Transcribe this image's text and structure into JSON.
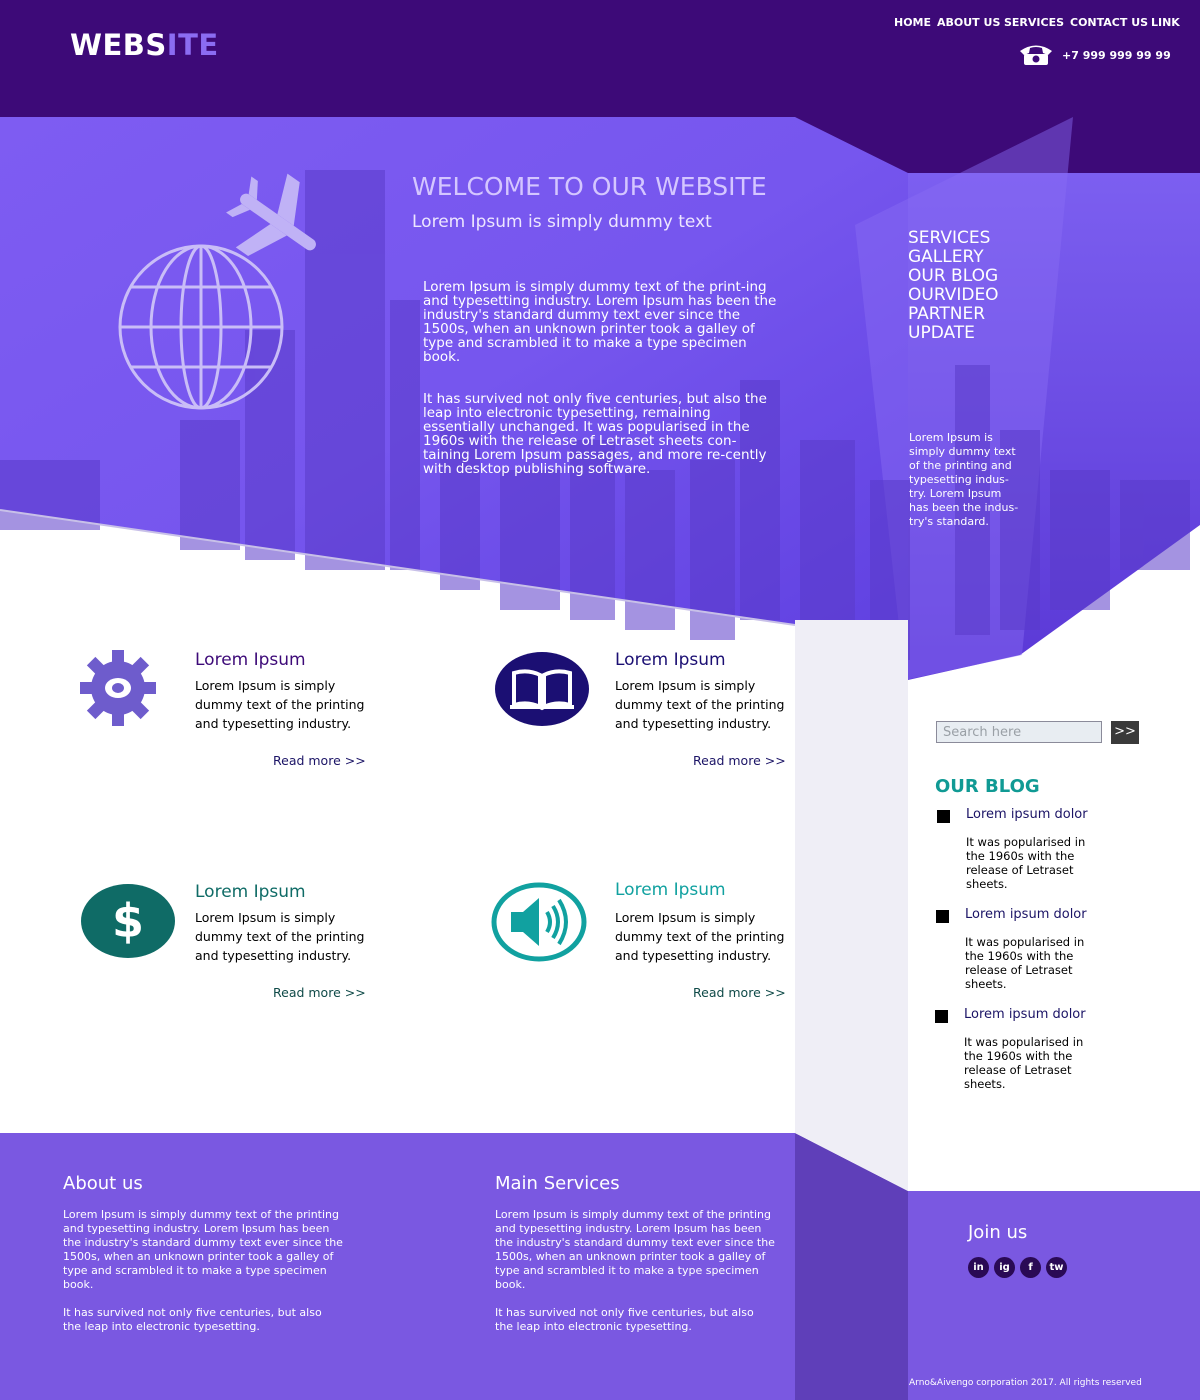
{
  "header": {
    "logo_main": "WEBS",
    "logo_highlight": "ITE",
    "nav": [
      "HOME",
      "ABOUT US",
      "SERVICES",
      "CONTACT US",
      "LINK"
    ],
    "phone": "+7 999 999 99 99"
  },
  "hero": {
    "title": "WELCOME TO OUR WEBSITE",
    "subtitle": "Lorem Ipsum is simply dummy text",
    "para1": "Lorem Ipsum is simply dummy text of the print-ing and typesetting industry. Lorem Ipsum has been the industry's standard dummy text ever since the 1500s, when an unknown printer took a galley of type and scrambled it to make a type specimen book.",
    "para2": "It has survived not only five centuries, but also the leap into electronic typesetting, remaining essentially unchanged. It was popularised in the 1960s with the release of Letraset sheets con-taining Lorem Ipsum passages, and more re-cently with desktop publishing software."
  },
  "side_menu": {
    "items": [
      "SERVICES",
      "GALLERY",
      "OUR BLOG",
      "OURVIDEO",
      "PARTNER",
      "UPDATE"
    ],
    "note": "Lorem Ipsum is simply dummy text of the printing and typesetting indus-try. Lorem Ipsum has been the indus-try's standard."
  },
  "features": [
    {
      "title": "Lorem Ipsum",
      "text": "Lorem Ipsum is simply dummy text of the printing and typesetting industry.",
      "link": "Read more >>",
      "icon": "gear-icon"
    },
    {
      "title": "Lorem Ipsum",
      "text": "Lorem Ipsum is simply dummy text of the printing and typesetting industry.",
      "link": "Read more >>",
      "icon": "book-icon"
    },
    {
      "title": "Lorem Ipsum",
      "text": "Lorem Ipsum is simply dummy text of the printing and typesetting industry.",
      "link": "Read more >>",
      "icon": "dollar-icon"
    },
    {
      "title": "Lorem Ipsum",
      "text": "Lorem Ipsum is simply dummy text of the printing and typesetting industry.",
      "link": "Read more >>",
      "icon": "speaker-icon"
    }
  ],
  "search": {
    "placeholder": "Search here",
    "button": ">>"
  },
  "blog": {
    "title": "OUR BLOG",
    "posts": [
      {
        "title": "Lorem ipsum dolor",
        "text": "It was popularised in the 1960s with the release of Letraset sheets."
      },
      {
        "title": "Lorem ipsum dolor",
        "text": "It was popularised in the 1960s with the release of Letraset sheets."
      },
      {
        "title": "Lorem ipsum dolor",
        "text": "It was popularised in the 1960s with the release of Letraset sheets."
      }
    ]
  },
  "footer": {
    "about_title": "About us",
    "about_p1": "Lorem Ipsum is simply dummy text of the printing and typesetting industry. Lorem Ipsum has been the industry's standard dummy text ever since the 1500s, when an unknown printer took a galley of type and scrambled it to make a type specimen book.",
    "about_p2": "It has survived not only five centuries, but also the leap into electronic typesetting.",
    "services_title": "Main Services",
    "services_p1": "Lorem Ipsum is simply dummy text of the printing and typesetting industry. Lorem Ipsum has been the industry's standard dummy text ever since the 1500s, when an unknown printer took a galley of type and scrambled it to make a type specimen book.",
    "services_p2": "It has survived not only five centuries, but also the leap into electronic typesetting.",
    "join_title": "Join us",
    "social": [
      "in",
      "ig",
      "f",
      "tw"
    ],
    "copyright": "Arno&Aivengo corporation 2017. All rights reserved"
  },
  "colors": {
    "header": "#3d0a78",
    "hero": "#6a45f0",
    "footer": "#7a58e1",
    "accent_teal": "#109a94",
    "gear": "#6e5ccc",
    "book": "#1b0f73",
    "dollar": "#0f6b66"
  }
}
